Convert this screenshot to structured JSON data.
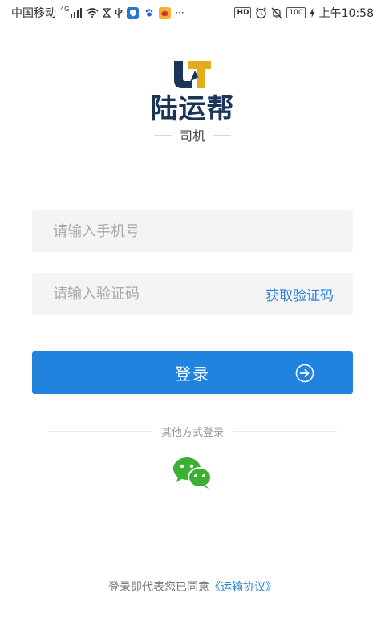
{
  "status_bar": {
    "carrier": "中国移动",
    "network": "4G",
    "more": "···",
    "hd": "HD",
    "battery": "100",
    "time": "上午10:58"
  },
  "logo": {
    "brand": "陆运帮",
    "role": "司机"
  },
  "form": {
    "phone_placeholder": "请输入手机号",
    "code_placeholder": "请输入验证码",
    "get_code_label": "获取验证码"
  },
  "login": {
    "label": "登录"
  },
  "other_login": {
    "label": "其他方式登录"
  },
  "agreement": {
    "prefix": "登录即代表您已同意",
    "link": "《运输协议》"
  },
  "colors": {
    "primary": "#2084de",
    "link": "#2a84d8",
    "brand_navy": "#1b3558",
    "brand_gold": "#e3ac1c",
    "wechat": "#3cb034"
  }
}
